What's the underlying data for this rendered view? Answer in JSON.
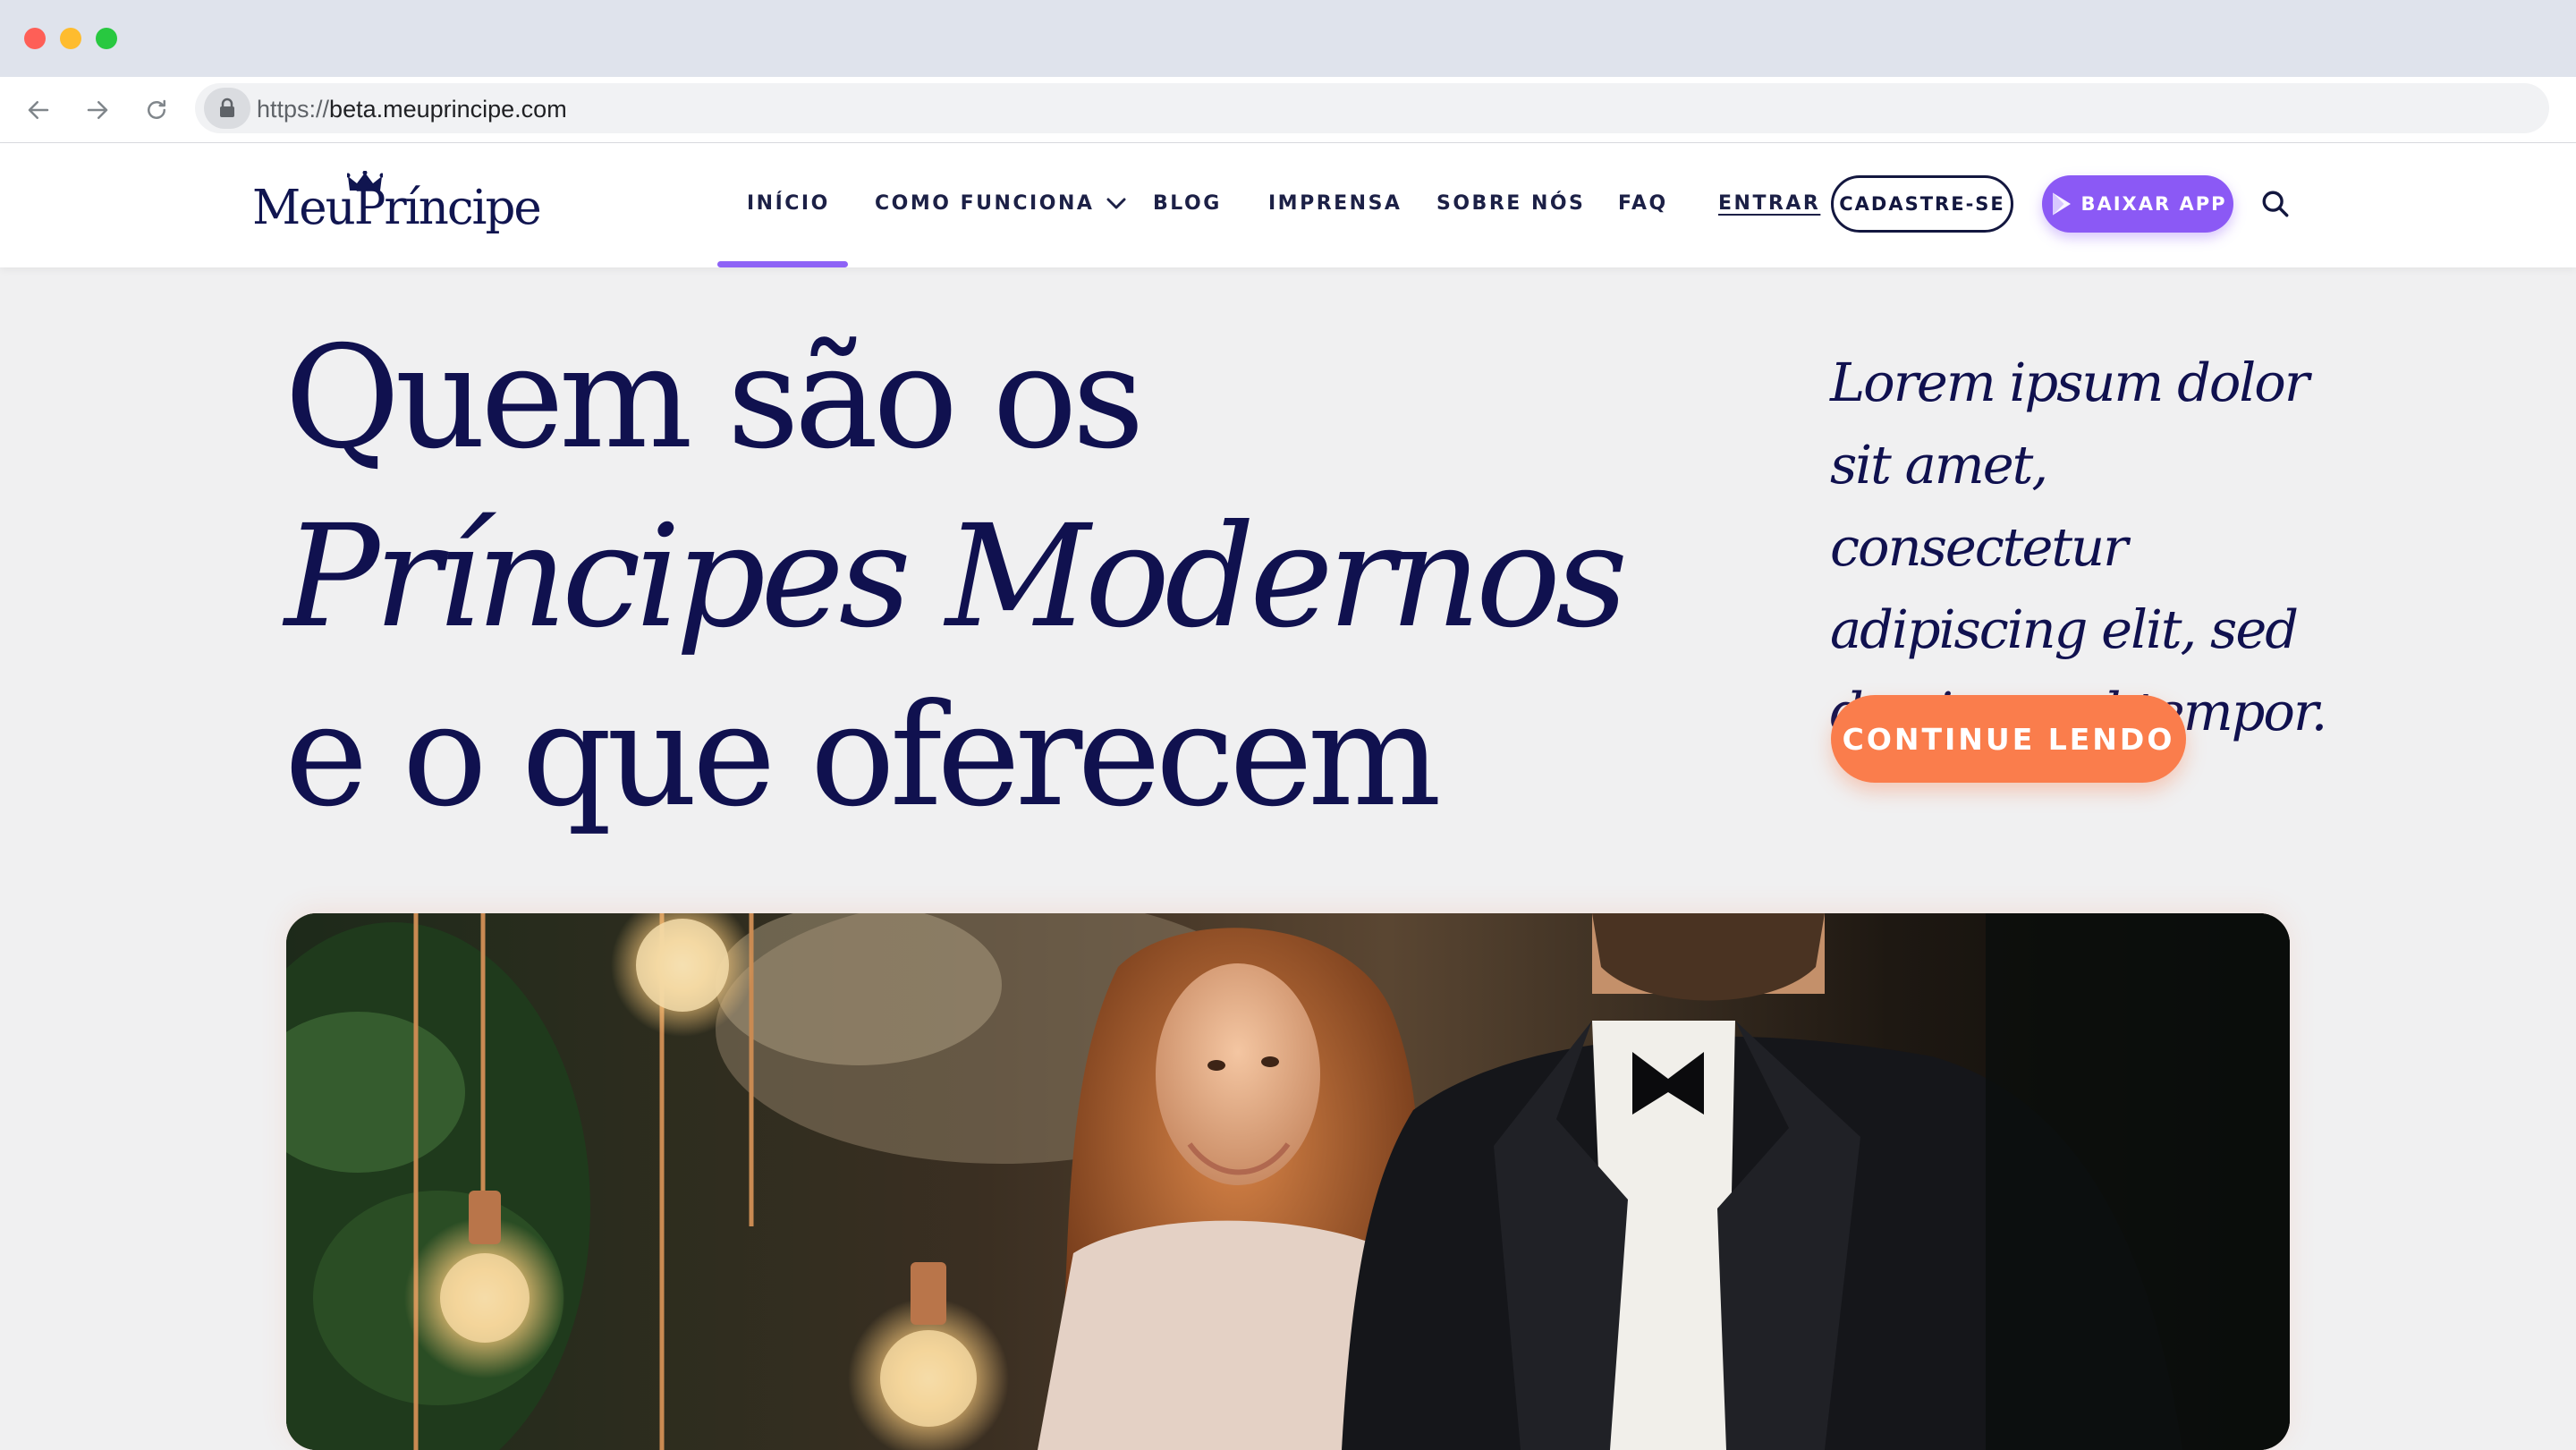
{
  "browser": {
    "url_protocol": "https://",
    "url_host": "beta.meuprincipe.com"
  },
  "header": {
    "logo": "MeuPríncipe",
    "menu": {
      "inicio": "INÍCIO",
      "como_funciona": "COMO FUNCIONA",
      "blog": "BLOG",
      "imprensa": "IMPRENSA",
      "sobre": "SOBRE NÓS",
      "faq": "FAQ",
      "entrar": "ENTRAR"
    },
    "cadastre_label": "CADASTRE-SE",
    "baixar_label": "BAIXAR APP",
    "active_item": "INÍCIO"
  },
  "hero": {
    "title_line1": "Quem são os",
    "title_line2": "Príncipes Modernos",
    "title_line3": "e o que oferecem",
    "blurb": "Lorem ipsum dolor sit amet, consectetur adipiscing elit, sed do eiusmod tempor.",
    "cta_label": "CONTINUE LENDO"
  },
  "colors": {
    "navy": "#10114f",
    "accent_purple": "#8b59f5",
    "accent_orange": "#fa7d4c",
    "page_bg": "#f0f0f1"
  },
  "icons": [
    "back-arrow-icon",
    "forward-arrow-icon",
    "reload-icon",
    "lock-icon",
    "crown-icon",
    "chevron-down-icon",
    "play-store-icon",
    "search-icon"
  ]
}
